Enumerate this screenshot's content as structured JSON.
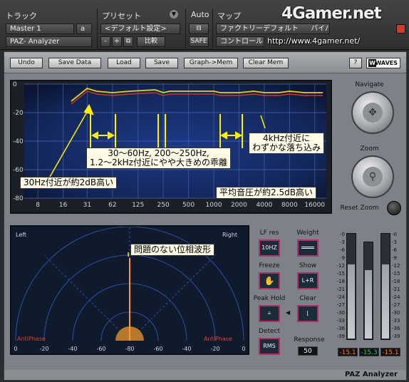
{
  "host": {
    "track_label": "トラック",
    "preset_label": "プリセット",
    "auto_label": "Auto",
    "map_label": "マップ",
    "track_name": "Master 1",
    "track_channel": "a",
    "plugin_name": "PAZ- Analyzer",
    "preset_name": "<デフォルト設定>",
    "minus": "-",
    "plus": "+",
    "compare": "比較",
    "safe": "SAFE",
    "factory_default": "ファクトリーデフォルト",
    "bypass": "バイパス",
    "controller": "コントロール"
  },
  "watermark": {
    "logo": "4Gamer.net",
    "url": "http://www.4gamer.net/"
  },
  "toolbar": {
    "undo": "Undo",
    "save_data": "Save Data",
    "load": "Load",
    "save": "Save",
    "graph_mem": "Graph->Mem",
    "clear_mem": "Clear Mem",
    "help": "?",
    "brand": "WAVES"
  },
  "analyzer": {
    "y_ticks": [
      "0",
      "-20",
      "-40",
      "-60",
      "-80"
    ],
    "x_ticks": [
      "8",
      "16",
      "31",
      "62",
      "125",
      "250",
      "500",
      "1000",
      "2000",
      "4000",
      "8000",
      "16000"
    ]
  },
  "chart_data": {
    "type": "line",
    "x": [
      20,
      31,
      40,
      62,
      100,
      200,
      250,
      300,
      500,
      1000,
      1200,
      2000,
      3000,
      4000,
      6000,
      8000,
      12000,
      16000,
      20000
    ],
    "series": [
      {
        "values": [
          -12,
          -3,
          -5,
          -6,
          -5,
          -4,
          -6,
          -5,
          -5,
          -5,
          -6,
          -6,
          -5,
          -6,
          -6,
          -5,
          -6,
          -6,
          -6
        ]
      },
      {
        "values": [
          -14,
          -5,
          -7,
          -8,
          -7,
          -6,
          -8,
          -7,
          -7,
          -7,
          -8,
          -8,
          -7,
          -8,
          -8,
          -7,
          -8,
          -8,
          -8
        ]
      }
    ],
    "ylim": [
      -80,
      0
    ],
    "log_x": true,
    "grid": true
  },
  "navigate": {
    "title": "Navigate",
    "zoom": "Zoom",
    "reset_zoom": "Reset Zoom"
  },
  "phase": {
    "left": "Left",
    "right": "Right",
    "anti_left": "AntiPhase",
    "anti_right": "AntiPhase",
    "x_ticks": [
      "0",
      "-20",
      "-40",
      "-60",
      "-80",
      "-60",
      "-40",
      "-20",
      "0"
    ]
  },
  "controls": {
    "lf_res": "LF res",
    "lf_res_value": "10HZ",
    "weight": "Weight",
    "freeze": "Freeze",
    "show": "Show",
    "show_value": "L+R",
    "peak_hold": "Peak Hold",
    "clear": "Clear",
    "detect": "Detect",
    "detect_value": "RMS",
    "response": "Response",
    "response_value": "50"
  },
  "meters": {
    "scale": [
      "-0",
      "-3",
      "-6",
      "-9",
      "-12",
      "-15",
      "-18",
      "-21",
      "-24",
      "-27",
      "-30",
      "-33",
      "-36",
      "-39"
    ],
    "left_value": "-15.1",
    "mid_value": "-15.3",
    "right_value": "-15.1",
    "left_color": "#ff7a2a",
    "mid_color": "#30c060",
    "right_color": "#ff7a2a"
  },
  "footer": {
    "name": "PAZ Analyzer"
  },
  "annotations": {
    "band_note_1": "30〜60Hz, 200〜250Hz,",
    "band_note_2": "1.2〜2kHz付近にやや大きめの乖離",
    "dip_note_1": "4kHz付近に",
    "dip_note_2": "わずかな落ち込み",
    "hz30_note": "30Hz付近が約2dB高い",
    "avg_note": "平均音圧が約2.5dB高い",
    "phase_note": "問題のない位相波形"
  }
}
